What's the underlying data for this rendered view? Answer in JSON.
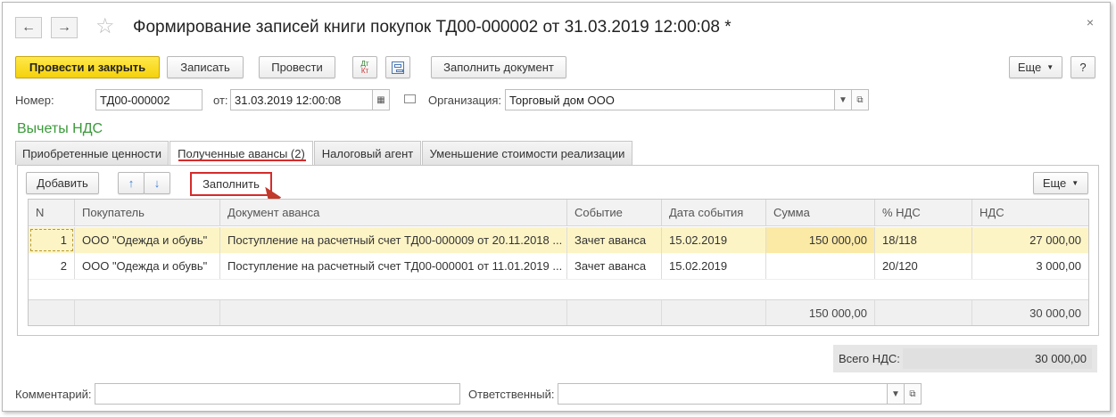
{
  "window": {
    "title": "Формирование записей книги покупок ТД00-000002 от 31.03.2019 12:00:08 *",
    "close_glyph": "×"
  },
  "nav": {
    "back": "←",
    "forward": "→",
    "star": "☆"
  },
  "toolbar": {
    "post_close": "Провести и закрыть",
    "save": "Записать",
    "post": "Провести",
    "dt_kt": "Дт Кт",
    "fill_doc": "Заполнить документ",
    "more": "Еще",
    "help": "?"
  },
  "header": {
    "number_label": "Номер:",
    "number_value": "ТД00-000002",
    "date_label": "от:",
    "date_value": "31.03.2019 12:00:08",
    "org_label": "Организация:",
    "org_value": "Торговый дом ООО"
  },
  "section_title": "Вычеты НДС",
  "tabs": [
    {
      "label": "Приобретенные ценности"
    },
    {
      "label": "Полученные авансы (2)"
    },
    {
      "label": "Налоговый агент"
    },
    {
      "label": "Уменьшение стоимости реализации"
    }
  ],
  "table_toolbar": {
    "add": "Добавить",
    "up": "↑",
    "down": "↓",
    "fill": "Заполнить",
    "more": "Еще"
  },
  "table": {
    "columns": [
      "N",
      "Покупатель",
      "Документ аванса",
      "Событие",
      "Дата события",
      "Сумма",
      "% НДС",
      "НДС"
    ],
    "rows": [
      {
        "n": "1",
        "buyer": "ООО \"Одежда и обувь\"",
        "doc": "Поступление на расчетный счет ТД00-000009 от 20.11.2018 ...",
        "event": "Зачет аванса",
        "date": "15.02.2019",
        "sum": "150 000,00",
        "rate": "18/118",
        "vat": "27 000,00"
      },
      {
        "n": "2",
        "buyer": "ООО \"Одежда и обувь\"",
        "doc": "Поступление на расчетный счет ТД00-000001 от 11.01.2019 ...",
        "event": "Зачет аванса",
        "date": "15.02.2019",
        "sum": "",
        "rate": "20/120",
        "vat": "3 000,00"
      }
    ],
    "totals": {
      "sum": "150 000,00",
      "vat": "30 000,00"
    }
  },
  "summary": {
    "label": "Всего НДС:",
    "value": "30 000,00"
  },
  "footer": {
    "comment_label": "Комментарий:",
    "comment_value": "",
    "responsible_label": "Ответственный:",
    "responsible_value": ""
  },
  "colors": {
    "accent_yellow": "#f5d10c",
    "section_green": "#3a9a3a",
    "highlight_red": "#d62b2b",
    "selected_row": "#fdf4c6"
  }
}
